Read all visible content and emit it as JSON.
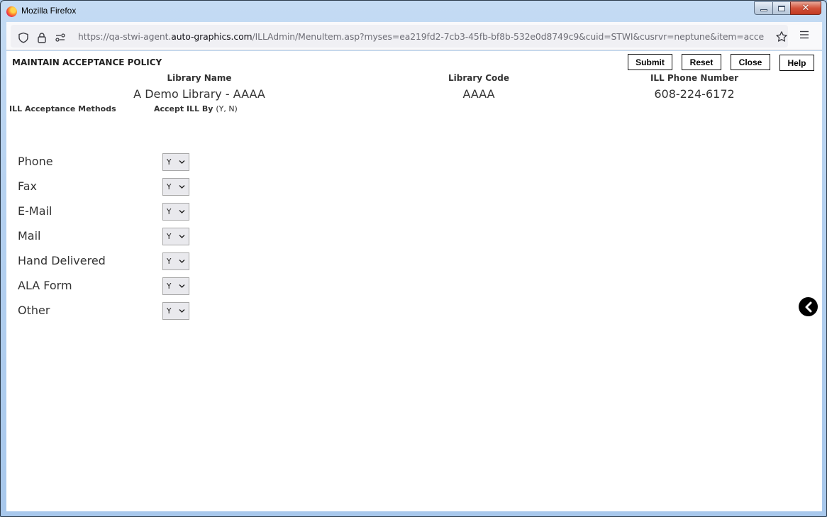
{
  "window": {
    "title": "Mozilla Firefox",
    "controls": {
      "minimize": "minimize",
      "maximize": "maximize",
      "close": "close"
    }
  },
  "browser": {
    "url_prefix": "https://qa-stwi-agent.",
    "url_domain": "auto-graphics.com",
    "url_suffix": "/ILLAdmin/MenuItem.asp?myses=ea219fd2-7cb3-45fb-bf8b-532e0d8749c9&cuid=STWI&cusrvr=neptune&item=acce",
    "icons": [
      "shield-icon",
      "lock-icon",
      "permissions-icon",
      "star-icon",
      "menu-icon"
    ]
  },
  "page": {
    "title": "MAINTAIN ACCEPTANCE POLICY",
    "buttons": {
      "submit": "Submit",
      "reset": "Reset",
      "close": "Close",
      "help": "Help"
    },
    "library": {
      "name_label": "Library Name",
      "name_value": "A Demo Library - AAAA",
      "code_label": "Library Code",
      "code_value": "AAAA",
      "phone_label": "ILL Phone Number",
      "phone_value": "608-224-6172"
    },
    "methods_header": "ILL Acceptance Methods",
    "accept_header": "Accept ILL By",
    "accept_hint": "(Y, N)",
    "methods": [
      {
        "label": "Phone",
        "value": "Y"
      },
      {
        "label": "Fax",
        "value": "Y"
      },
      {
        "label": "E-Mail",
        "value": "Y"
      },
      {
        "label": "Mail",
        "value": "Y"
      },
      {
        "label": "Hand Delivered",
        "value": "Y"
      },
      {
        "label": "ALA Form",
        "value": "Y"
      },
      {
        "label": "Other",
        "value": "Y"
      }
    ],
    "side_toggle_icon": "chevron-left-icon"
  }
}
